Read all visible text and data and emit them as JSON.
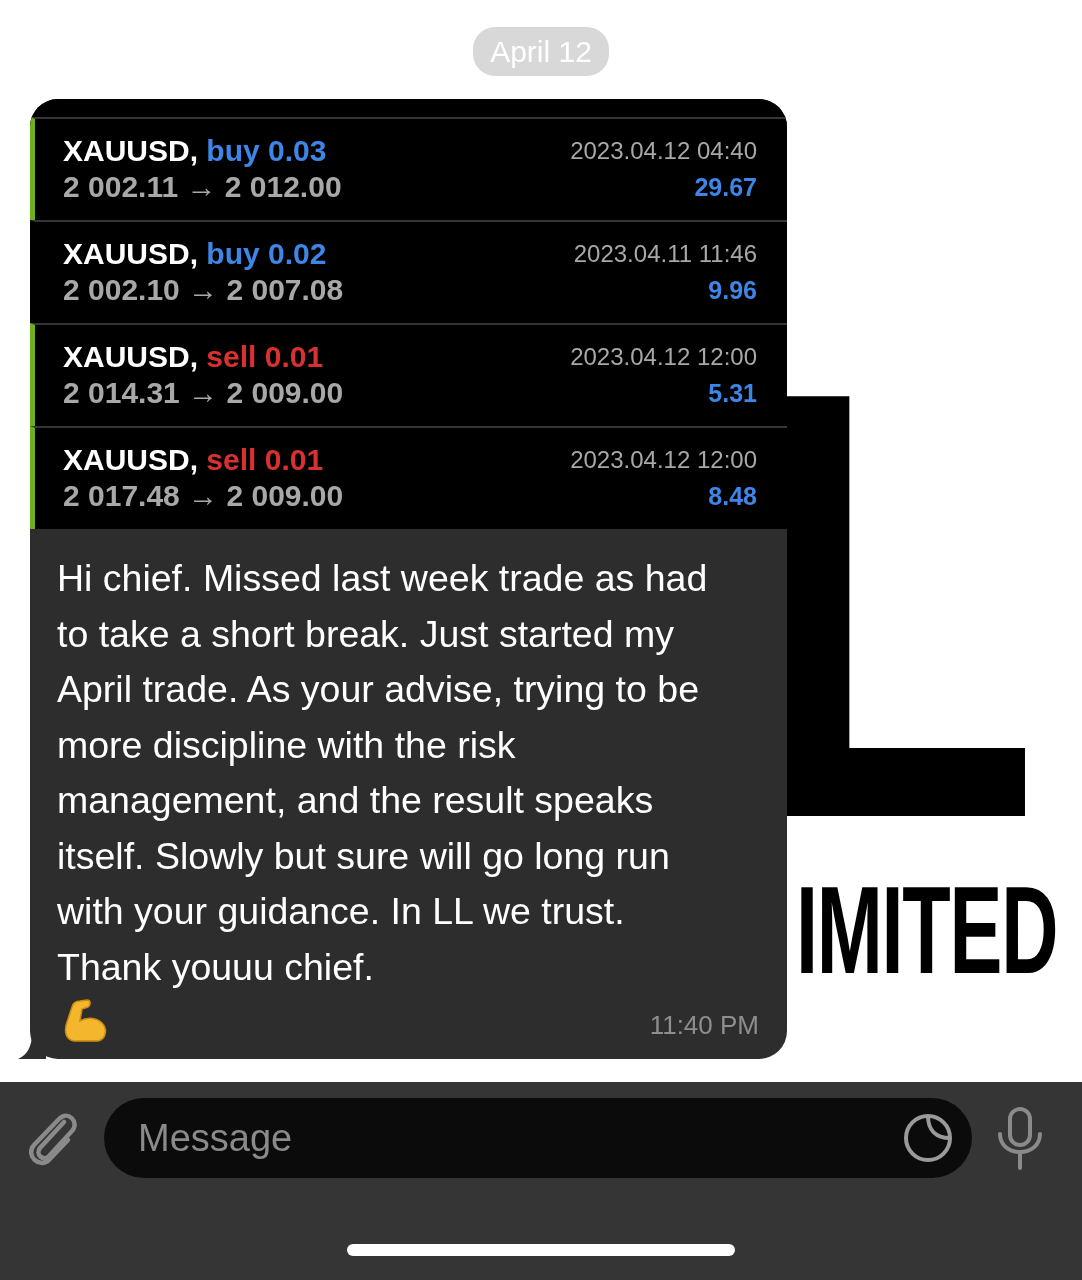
{
  "date_chip": "April 12",
  "wallpaper": {
    "logo_letter": "L",
    "logo_word": "IMITED"
  },
  "message": {
    "trades": [
      {
        "symbol": "XAUUSD,",
        "side": "buy",
        "lot": "0.03",
        "prices": "2 002.11 → 2 012.00",
        "time": "2023.04.12 04:40",
        "profit": "29.67",
        "marked": true
      },
      {
        "symbol": "XAUUSD,",
        "side": "buy",
        "lot": "0.02",
        "prices": "2 002.10 → 2 007.08",
        "time": "2023.04.11 11:46",
        "profit": "9.96",
        "marked": false
      },
      {
        "symbol": "XAUUSD,",
        "side": "sell",
        "lot": "0.01",
        "prices": "2 014.31 → 2 009.00",
        "time": "2023.04.12 12:00",
        "profit": "5.31",
        "marked": true
      },
      {
        "symbol": "XAUUSD,",
        "side": "sell",
        "lot": "0.01",
        "prices": "2 017.48 → 2 009.00",
        "time": "2023.04.12 12:00",
        "profit": "8.48",
        "marked": true
      }
    ],
    "text": "Hi chief. Missed last week trade as had to take a short break. Just started my April trade. As your advise, trying to be more discipline with the risk management, and the result speaks itself. Slowly but sure will go long run with your guidance. In LL we trust. Thank youuu chief.",
    "time": "11:40 PM"
  },
  "composer": {
    "placeholder": "Message"
  }
}
